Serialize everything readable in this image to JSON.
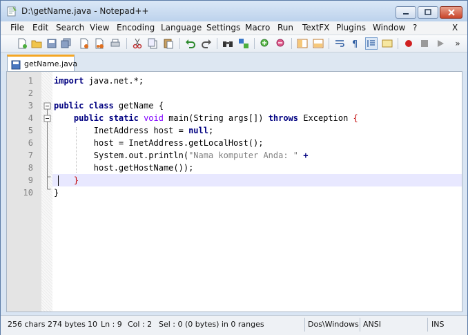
{
  "window": {
    "title": "D:\\getName.java - Notepad++"
  },
  "menu": {
    "items": [
      "File",
      "Edit",
      "Search",
      "View",
      "Encoding",
      "Language",
      "Settings",
      "Macro",
      "Run",
      "TextFX",
      "Plugins",
      "Window",
      "?"
    ],
    "close_label": "X"
  },
  "toolbar": {
    "icons": [
      "new-file-icon",
      "open-file-icon",
      "save-icon",
      "save-all-icon",
      "close-icon",
      "close-all-icon",
      "print-icon",
      "cut-icon",
      "copy-icon",
      "paste-icon",
      "undo-icon",
      "redo-icon",
      "find-icon",
      "replace-icon",
      "zoom-in-icon",
      "zoom-out-icon",
      "sync-v-icon",
      "sync-h-icon",
      "word-wrap-icon",
      "show-all-chars-icon",
      "indent-guide-icon",
      "user-lang-icon",
      "record-macro-icon",
      "stop-record-icon",
      "play-macro-icon"
    ],
    "overflow_label": "»"
  },
  "tab": {
    "label": "getName.java"
  },
  "editor": {
    "line_numbers": [
      "1",
      "2",
      "3",
      "4",
      "5",
      "6",
      "7",
      "8",
      "9",
      "10"
    ]
  },
  "status": {
    "chars": "256 chars",
    "bytes": "274 bytes",
    "lines": "10",
    "ln": "Ln : 9",
    "col": "Col : 2",
    "sel": "Sel : 0 (0 bytes) in 0 ranges",
    "eol": "Dos\\Windows",
    "encoding": "ANSI",
    "mode": "INS"
  },
  "colors": {
    "keyword": "#000080",
    "type": "#8000ff",
    "string": "#808080",
    "current_line": "#e8e8ff"
  }
}
